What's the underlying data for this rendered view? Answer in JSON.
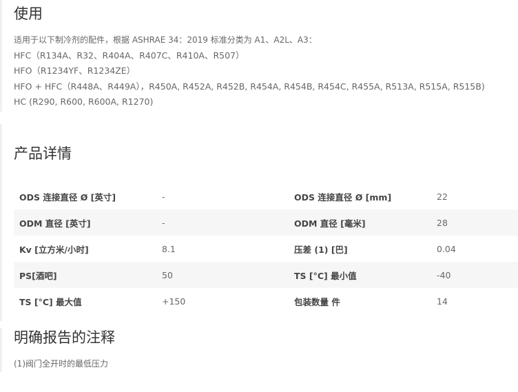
{
  "usage": {
    "title": "使用",
    "intro": "适用于以下制冷剂的配件，根据 ASHRAE 34：2019 标准分类为 A1、A2L、A3：",
    "lines": [
      "HFC（R134A、R32、R404A、R407C、R410A、R507）",
      "HFO（R1234YF、R1234ZE）",
      "HFO + HFC（R448A、R449A），R450A, R452A, R452B, R454A, R454B, R454C, R455A, R513A, R515A, R515B)",
      "HC (R290, R600, R600A, R1270)"
    ]
  },
  "details": {
    "title": "产品详情",
    "rows": [
      {
        "l1": "ODS 连接直径 Ø [英寸]",
        "v1": "-",
        "l2": "ODS 连接直径 Ø [mm]",
        "v2": "22"
      },
      {
        "l1": "ODM 直径 [英寸]",
        "v1": "-",
        "l2": "ODM 直径 [毫米]",
        "v2": "28"
      },
      {
        "l1": "Kv [立方米/小时]",
        "v1": "8.1",
        "l2": "压差 (1) [巴]",
        "v2": "0.04"
      },
      {
        "l1": "PS[酒吧]",
        "v1": "50",
        "l2": "TS [°C] 最小值",
        "v2": "-40"
      },
      {
        "l1": "TS [°C] 最大值",
        "v1": "+150",
        "l2": "包装数量 件",
        "v2": "14"
      }
    ]
  },
  "notes": {
    "title": "明确报告的注释",
    "text": "(1)阀门全开时的最低压力"
  }
}
